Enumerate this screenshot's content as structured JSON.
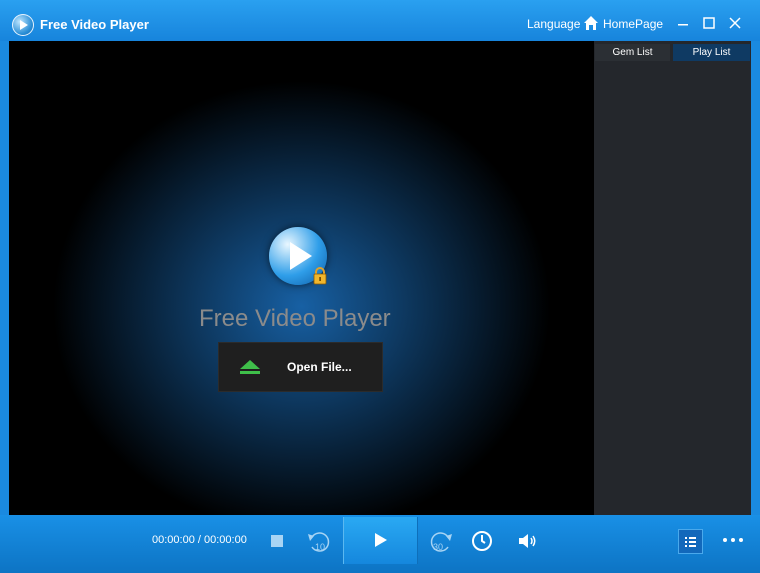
{
  "window": {
    "title": "Free Video Player",
    "language_label": "Language",
    "homepage_label": "HomePage",
    "icons": [
      "app-logo-icon",
      "home-icon",
      "minimize-icon",
      "maximize-icon",
      "close-icon"
    ]
  },
  "sidebar": {
    "tabs": [
      {
        "label": "Gem List"
      },
      {
        "label": "Play List"
      }
    ]
  },
  "player": {
    "center_title": "Free Video Player",
    "open_file_label": "Open File..."
  },
  "controls": {
    "time": "00:00:00 / 00:00:00",
    "rewind_seconds": "10",
    "forward_seconds": "30",
    "icons": [
      "stop-icon",
      "rewind-icon",
      "play-icon",
      "forward-icon",
      "timer-icon",
      "volume-icon",
      "playlist-icon",
      "more-icon"
    ]
  },
  "colors": {
    "titlebar": "#1a8ae0",
    "video_bg": "#000000",
    "sidebar_bg": "#24272c",
    "active_tab": "#0f3a63",
    "control_bar": "#1386dc"
  }
}
